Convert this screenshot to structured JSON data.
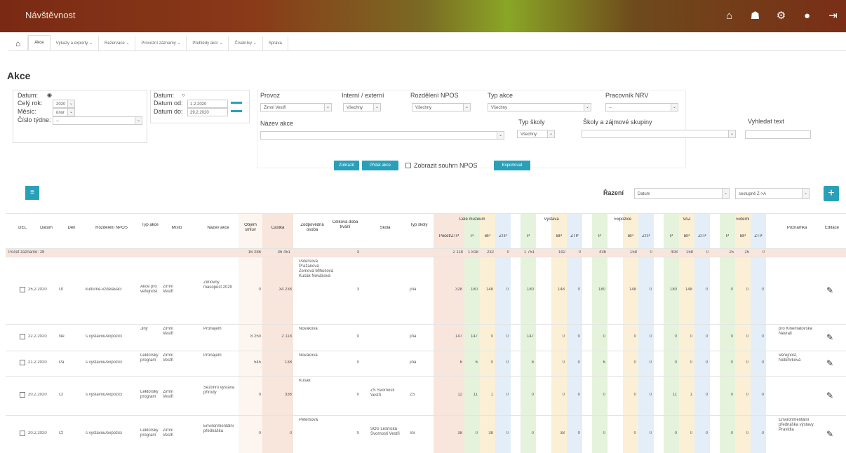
{
  "app": {
    "brand": "Návštěvnost"
  },
  "topbar_icons": [
    "home-icon",
    "users-icon",
    "gear-icon",
    "user-icon",
    "logout-icon"
  ],
  "nav": {
    "home_icon": "⌂",
    "tabs": [
      "Akce",
      "Výkazy a exporty ⌄",
      "Rezervace ⌄",
      "Provozní záznamy ⌄",
      "Přehledy akcí ⌄",
      "Číselníky ⌄",
      "Správa"
    ]
  },
  "page_title": "Akce",
  "filters": {
    "date_radio1_label": "Datum:",
    "celyrok_label": "Celý rok:",
    "celyrok_value": "2020",
    "mesic_label": "Měsíc:",
    "mesic_value": "únor",
    "cislo_tydne_label": "Číslo týdne:",
    "cislo_tydne_value": "--",
    "date_radio2_label": "Datum:",
    "datum_od_label": "Datum od:",
    "datum_od_value": "1.2.2020",
    "datum_do_label": "Datum do:",
    "datum_do_value": "29.2.2020",
    "provoz_label": "Provoz",
    "provoz_value": "Zimní Vestři",
    "interni_label": "Interní / externí",
    "interni_value": "Všechny",
    "rozdeleni_label": "Rozdělení NPOS",
    "rozdeleni_value": "Všechny",
    "typ_akce_label": "Typ akce",
    "typ_akce_value": "Všechny",
    "pracovnik_label": "Pracovník NRV",
    "pracovnik_value": "--",
    "nazev_akce_label": "Název akce",
    "typ_skoly_label": "Typ školy",
    "typ_skoly_value": "Všechny",
    "skoly_label": "Školy a zájmové skupiny",
    "vyhledat_label": "Vyhledat text"
  },
  "buttons": {
    "zobrazit": "Zobrazit",
    "pridat": "Přidat akce",
    "zobrazit_souhrn_label": "Zobrazit souhrn NPOS",
    "exportovat": "Exportovat"
  },
  "sort": {
    "label": "Řazení",
    "field": "Datum",
    "order": "sestupně Z->A"
  },
  "table": {
    "headers": [
      "DEL",
      "Datum",
      "Den",
      "Rozdělení NPOS",
      "Typ akce",
      "Místo",
      "Název akce",
      "Objem smluv",
      "Částka",
      "Zodpovědná osoba",
      "Celková doba trvání",
      "Škola",
      "Typ školy",
      "Celé muzeum",
      "Výstava",
      "Expozice",
      "VAZ",
      "Externí",
      "Poznámka",
      "Editace"
    ],
    "sub_headers": [
      "Počet/ZTP",
      "P",
      "BP",
      "ZTP",
      "P",
      "BP",
      "ZTP",
      "P",
      "BP",
      "ZTP",
      "P",
      "BP",
      "ZTP",
      "P",
      "BP",
      "ZTP"
    ],
    "summary": {
      "label": "Počet záznamů: 28",
      "objem": "16 286",
      "castka": "36 451",
      "doba": "3",
      "nums": [
        "2 118",
        "1 818",
        "232",
        "0",
        "1 751",
        "192",
        "0",
        "436",
        "158",
        "0",
        "408",
        "158",
        "0",
        "25",
        "25",
        "0"
      ]
    },
    "rows": [
      {
        "datum": "25.2.2020",
        "den": "Út",
        "rozdeleni": "kulturně-vzdělávací",
        "typ": "Akce pro veřejnost",
        "misto": "Zimní Vestři",
        "nazev": "Zimovny masopust 2020",
        "objem": "0",
        "castka": "34 238",
        "osoba": "Petersová Pražanová Zemová Mlhošová Kusák Nováková",
        "doba": "3",
        "skola": "",
        "typ_skoly": "jiná",
        "nums": [
          "328",
          "180",
          "148",
          "0",
          "180",
          "148",
          "0",
          "180",
          "148",
          "0",
          "180",
          "148",
          "0",
          "0",
          "0",
          "0"
        ],
        "poznamka": ""
      },
      {
        "datum": "22.2.2020",
        "den": "Ne",
        "rozdeleni": "s výstavou/expozicí",
        "typ": "Jiný",
        "misto": "Zimní Vestři",
        "nazev": "Pronájem",
        "objem": "8 250",
        "castka": "2 118",
        "osoba": "Nováková",
        "doba": "0",
        "skola": "",
        "typ_skoly": "jiná",
        "nums": [
          "147",
          "147",
          "0",
          "0",
          "147",
          "0",
          "0",
          "0",
          "0",
          "0",
          "0",
          "0",
          "0",
          "0",
          "0",
          "0"
        ],
        "poznamka": "pro Kinematovská Nevrali"
      },
      {
        "datum": "21.2.2020",
        "den": "Pá",
        "rozdeleni": "s výstavou/expozicí",
        "typ": "Lektorský program",
        "misto": "Zimní Vestři",
        "nazev": "Pronájem",
        "objem": "545",
        "castka": "138",
        "osoba": "Nováková",
        "doba": "0",
        "skola": "",
        "typ_skoly": "jiná",
        "nums": [
          "6",
          "6",
          "0",
          "0",
          "6",
          "0",
          "0",
          "6",
          "0",
          "0",
          "0",
          "0",
          "0",
          "0",
          "0",
          "0"
        ],
        "poznamka": "Veřejnost, Netkřivková"
      },
      {
        "datum": "20.2.2020",
        "den": "Čt",
        "rozdeleni": "s výstavou/expozicí",
        "typ": "Lektorský program",
        "misto": "Zimní Vestři",
        "nazev": "Sezónní výstava přírody",
        "objem": "0",
        "castka": "336",
        "osoba": "Kusák",
        "doba": "0",
        "skola": "ZŠ Svornosti Vestři",
        "typ_skoly": "ZŠ",
        "nums": [
          "12",
          "11",
          "1",
          "0",
          "0",
          "0",
          "0",
          "0",
          "0",
          "0",
          "11",
          "1",
          "0",
          "0",
          "0",
          "0"
        ],
        "poznamka": ""
      },
      {
        "datum": "20.2.2020",
        "den": "Čt",
        "rozdeleni": "s výstavou/expozicí",
        "typ": "Lektorský program",
        "misto": "Zimní Vestři",
        "nazev": "Environmentální přednáška",
        "objem": "0",
        "castka": "0",
        "osoba": "Petersová",
        "doba": "0",
        "skola": "SOŠ Lesnická Svornosti Vestři",
        "typ_skoly": "SŠ",
        "nums": [
          "38",
          "0",
          "38",
          "0",
          "0",
          "38",
          "0",
          "0",
          "0",
          "0",
          "0",
          "0",
          "0",
          "0",
          "0",
          "0"
        ],
        "poznamka": "Environmentální přednáška výstavy Pravidla"
      }
    ]
  },
  "colors": {
    "accent": "#2aa0b8",
    "salmon": "#f8e6dc",
    "green": "#e6f3dc",
    "yellow": "#fbf0d6",
    "blue": "#e4eef8"
  }
}
